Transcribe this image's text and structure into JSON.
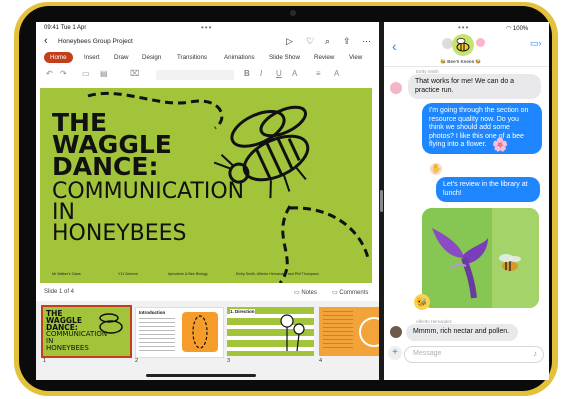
{
  "status": {
    "time": "09:41  Tue 1 Apr",
    "battery": "100%"
  },
  "pp": {
    "title": "Honeybees Group Project",
    "tabs": [
      "Home",
      "Insert",
      "Draw",
      "Design",
      "Transitions",
      "Animations",
      "Slide Show",
      "Review",
      "View"
    ],
    "slide": {
      "line1": "THE",
      "line2": "WAGGLE",
      "line3": "DANCE:",
      "line4": "COMMUNICATION",
      "line5": "IN",
      "line6": "HONEYBEES",
      "footer": [
        "Mr Walker's Class",
        "Y11 Science",
        "Apiculture & Bee Biology",
        "Emily Smith, Alberto Hernandez and Phil Thompson"
      ]
    },
    "slide_count": "Slide 1 of 4",
    "notes": "Notes",
    "comments": "Comments",
    "thumb_labels": [
      "1",
      "2",
      "3",
      "4"
    ],
    "thumb2_title": "Introduction",
    "thumb3_title": "1. Direction"
  },
  "msg": {
    "group_name": "🐝 Bee's Knees 🐝",
    "sender1": "Emily Smith",
    "b1": "That works for me! We can do a practice run.",
    "b2": "I'm going through the section on resource quality now. Do you think we should add some photos? I like this one of a bee flying into a flower.",
    "b3": "Let's review in the library at lunch!",
    "sender2": "Alberto Hernandez",
    "b4": "Mmmm, rich nectar and pollen.",
    "placeholder": "Message",
    "tapback": "🐝",
    "flower": "🌸"
  },
  "colors": {
    "accent": "#c43e1c",
    "slide_bg": "#a2c43a",
    "bubble_out": "#1e87ff",
    "tablet": "#e3c13a"
  }
}
